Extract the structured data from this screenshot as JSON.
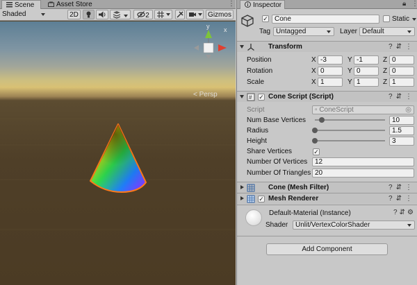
{
  "scene": {
    "tabs": [
      {
        "label": "Scene"
      },
      {
        "label": "Asset Store"
      }
    ],
    "toolbar": {
      "shading_mode": "Shaded",
      "mode_2d": "2D",
      "hidden_count": "2",
      "gizmos": "Gizmos"
    },
    "gizmo": {
      "x_label": "x",
      "y_label": "y",
      "projection": "Persp"
    },
    "colors": {
      "ground": "#4b3b24",
      "horizon": "#d9c174",
      "sky": "#5d7f95",
      "selection_outline": "#ff7a1a"
    }
  },
  "inspector": {
    "tab": "Inspector",
    "object": {
      "name": "Cone",
      "static_label": "Static",
      "tag_label": "Tag",
      "tag_value": "Untagged",
      "layer_label": "Layer",
      "layer_value": "Default"
    },
    "transform": {
      "title": "Transform",
      "rows": [
        {
          "label": "Position",
          "x": "-3",
          "y": "-1",
          "z": "0"
        },
        {
          "label": "Rotation",
          "x": "0",
          "y": "0",
          "z": "0"
        },
        {
          "label": "Scale",
          "x": "1",
          "y": "1",
          "z": "1"
        }
      ]
    },
    "cone_script": {
      "title": "Cone Script (Script)",
      "script_label": "Script",
      "script_value": "ConeScript",
      "num_base_vertices": {
        "label": "Num Base Vertices",
        "value": "10",
        "fraction": 0.1
      },
      "radius": {
        "label": "Radius",
        "value": "1.5",
        "fraction": 0.0
      },
      "height": {
        "label": "Height",
        "value": "3",
        "fraction": 0.0
      },
      "share_vertices": {
        "label": "Share Vertices",
        "checked": true
      },
      "num_vertices": {
        "label": "Number Of Vertices",
        "value": "12"
      },
      "num_triangles": {
        "label": "Number Of Triangles",
        "value": "20"
      }
    },
    "mesh_filter": {
      "title": "Cone (Mesh Filter)"
    },
    "mesh_renderer": {
      "title": "Mesh Renderer"
    },
    "material": {
      "name": "Default-Material (Instance)",
      "shader_label": "Shader",
      "shader_value": "Unlit/VertexColorShader"
    },
    "add_component": "Add Component"
  }
}
